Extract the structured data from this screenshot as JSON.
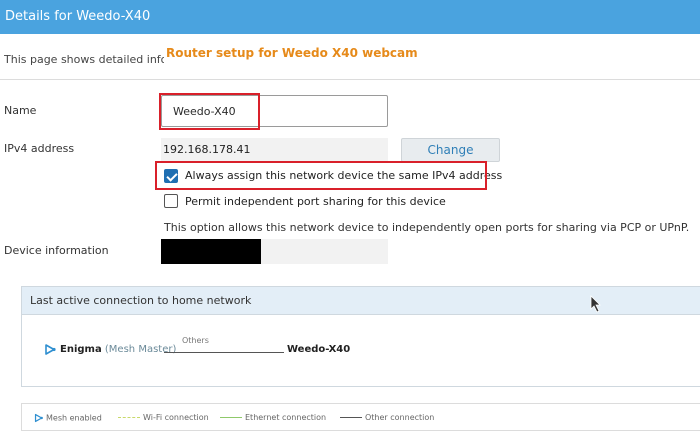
{
  "window": {
    "title": "Details for Weedo-X40"
  },
  "page": {
    "description": "This page shows detailed inform",
    "overlay_caption": "Router setup for Weedo X40 webcam"
  },
  "form": {
    "name_label": "Name",
    "name_value": "Weedo-X40",
    "ipv4_label": "IPv4 address",
    "ipv4_value": "192.168.178.41",
    "change_label": "Change",
    "always_assign_label": "Always assign this network device the same IPv4 address",
    "always_assign_checked": true,
    "permit_sharing_label": "Permit independent port sharing for this device",
    "permit_sharing_checked": false,
    "sharing_hint": "This option allows this network device to independently open ports for sharing via PCP or UPnP.",
    "device_info_label": "Device information"
  },
  "connection_panel": {
    "title": "Last active connection to home network",
    "source_name": "Enigma",
    "source_role": "(Mesh Master)",
    "connection_type": "Others",
    "target_name": "Weedo-X40"
  },
  "legend": {
    "mesh_enabled": "Mesh enabled",
    "wifi": "Wi-Fi connection",
    "ethernet": "Ethernet connection",
    "other": "Other connection"
  },
  "colors": {
    "titlebar": "#4aa3df",
    "accent_orange": "#e68a1a",
    "highlight_red": "#d9202a",
    "wifi_line": "#c8d96a",
    "ethernet_line": "#8fc96a",
    "other_line": "#555555"
  }
}
